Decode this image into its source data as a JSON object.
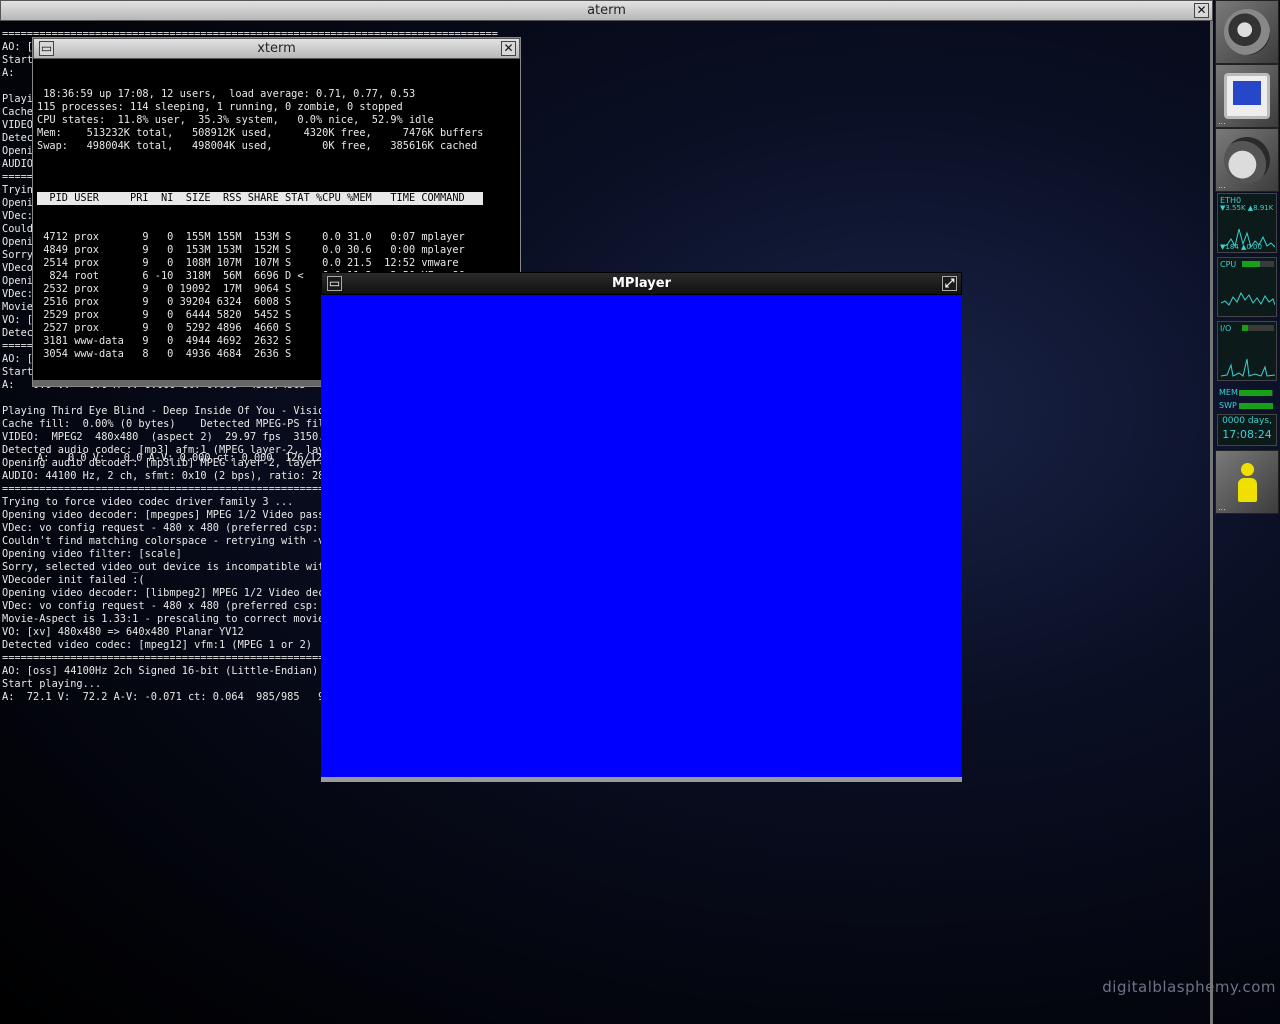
{
  "aterm": {
    "title": "aterm",
    "lines": [
      "================================================================================",
      "AO: [oss] 44100Hz 2ch Signed 16-bit (Little-Endian)",
      "Start playing...",
      "A:   0.0 V:   0.0 A-V: 0.000 ct: 0.000  4565/4565",
      "",
      "Playing The Corrs - Irresistible - Vision.M2V",
      "Cache fill:  0.00% (0 bytes)    Detected MPEG-PS file format!",
      "VIDEO:  MPEG2  480x480  (aspect 2)  29.97 fps  3150.0 kbps (393.8 kbyte/s)",
      "Detected audio codec: [mp3] afm:1 (MPEG layer-2, layer-3)",
      "Opening audio decoder: [mp3lib] MPEG layer-2, layer-3",
      "AUDIO: 44100 Hz, 2 ch, sfmt: 0x10 (2 bps), ratio: 28000->176400 (224.0 kbit)",
      "================================================================================",
      "Trying to force video codec driver family 3 ...",
      "Opening video decoder: [mpegpes] MPEG 1/2 Video passthrough",
      "VDec: vo config request - 480 x 480 (preferred csp: Mpeg PES)",
      "Couldn't find matching colorspace - retrying with -vop scale...",
      "Opening video filter: [scale]",
      "Sorry, selected video_out device is incompatible with this codec.",
      "VDecoder init failed :(",
      "Opening video decoder: [libmpeg2] MPEG 1/2 Video decoder v2.0",
      "VDec: vo config request - 480 x 480 (preferred csp: Planar YV12)",
      "Movie-Aspect is 1.33:1 - prescaling to correct movie aspect.",
      "VO: [xv] 480x480 => 640x480 Planar YV12",
      "Detected video codec: [mpeg12] vfm:1 (MPEG 1 or 2)",
      "================================================================================",
      "AO: [oss] 44100Hz 2ch Signed 16-bit (Little-Endian)",
      "Start playing...",
      "A:   0.0 V:   0.0 A-V: 0.000 ct: 0.000  4565/4565",
      "",
      "Playing Third Eye Blind - Deep Inside Of You - Vision.M2V",
      "Cache fill:  0.00% (0 bytes)    Detected MPEG-PS file format!",
      "VIDEO:  MPEG2  480x480  (aspect 2)  29.97 fps  3150.0 kbps (393.8 kbyte/s)",
      "Detected audio codec: [mp3] afm:1 (MPEG layer-2, layer-3)",
      "Opening audio decoder: [mp3lib] MPEG layer-2, layer-3",
      "AUDIO: 44100 Hz, 2 ch, sfmt: 0x10 (2 bps), ratio: 28000->176400 (224.0 kbit)",
      "================================================================================",
      "Trying to force video codec driver family 3 ...",
      "Opening video decoder: [mpegpes] MPEG 1/2 Video passthrough",
      "VDec: vo config request - 480 x 480 (preferred csp: Mpeg PES)",
      "Couldn't find matching colorspace - retrying with -vop scale...",
      "Opening video filter: [scale]",
      "Sorry, selected video_out device is incompatible with this codec.",
      "VDecoder init failed :(",
      "Opening video decoder: [libmpeg2] MPEG 1/2 Video decoder v2.0",
      "VDec: vo config request - 480 x 480 (preferred csp: Planar YV12)",
      "Movie-Aspect is 1.33:1 - prescaling to correct movie aspect.",
      "VO: [xv] 480x480 => 640x480 Planar YV12",
      "Detected video codec: [mpeg12] vfm:1 (MPEG 1 or 2)",
      "================================================================================",
      "AO: [oss] 44100Hz 2ch Signed 16-bit (Little-Endian)",
      "Start playing...",
      "A:  72.1 V:  72.2 A-V: -0.071 ct: 0.064  985/985   9%  2%  0.8% 0 0 49%"
    ]
  },
  "xterm": {
    "title": "xterm",
    "summary": [
      " 18:36:59 up 17:08, 12 users,  load average: 0.71, 0.77, 0.53",
      "115 processes: 114 sleeping, 1 running, 0 zombie, 0 stopped",
      "CPU states:  11.8% user,  35.3% system,   0.0% nice,  52.9% idle",
      "Mem:    513232K total,   508912K used,     4320K free,     7476K buffers",
      "Swap:   498004K total,   498004K used,        0K free,   385616K cached",
      ""
    ],
    "header": "  PID USER     PRI  NI  SIZE  RSS SHARE STAT %CPU %MEM   TIME COMMAND",
    "rows": [
      " 4712 prox       9   0  155M 155M  153M S     0.0 31.0   0:07 mplayer",
      " 4849 prox       9   0  153M 153M  152M S     0.0 30.6   0:00 mplayer",
      " 2514 prox       9   0  108M 107M  107M S     0.0 21.5  12:52 vmware",
      "  824 root       6 -10  318M  56M  6696 D <   6.0 11.3   2:50 XFree86",
      " 2532 prox       9   0 19092  17M  9064 S     0.0  3.4   0:39 kdeinit",
      " 2516 prox       9   0 39204 6324  6008 S     0.0  1.2   0:15 vmware-mks",
      " 2529 prox       9   0  6444 5820  5452 S     0.0  1.1   0:00 kdeinit",
      " 2527 prox       9   0  5292 4896  4660 S     0.0  0.9   0:00 kdeinit",
      " 3181 www-data   9   0  4944 4692  2632 S     0.0  0.9   0:00 apache",
      " 3054 www-data   8   0  4936 4684  2636 S     0.0  0.9   0:00 apache"
    ],
    "footer": "A:   0.0 V:   0.0 A-V: 0.000 ct: 0.000  126/126"
  },
  "mplayer": {
    "title": "MPlayer",
    "video_color": "#0000fe"
  },
  "dock": {
    "net_label": "ETH0",
    "net_rates": "▼3.55K ▲8.91K",
    "net_rates2": "▼184 ▲0.00",
    "cpu_label": "CPU",
    "cpu_level": 0.55,
    "io_label": "I/O",
    "mem_label": "MEM",
    "mem_level": 0.98,
    "swp_label": "SWP",
    "swp_level": 1.0,
    "uptime_days": "0000 days,",
    "uptime_time": "17:08:24",
    "dots": "..."
  },
  "watermark": "digitalblasphemy.com",
  "colors": {
    "video_blue": "#0000fe",
    "monitor_cyan": "#3fd0d0",
    "level_green": "#19a019"
  }
}
